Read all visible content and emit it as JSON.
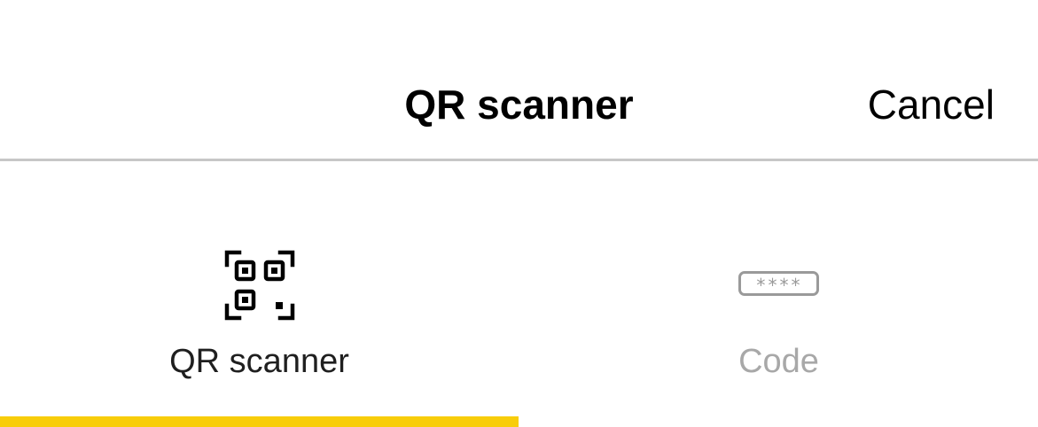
{
  "header": {
    "title": "QR scanner",
    "cancel_label": "Cancel"
  },
  "tabs": [
    {
      "label": "QR scanner",
      "icon": "qr-code-icon",
      "selected": true
    },
    {
      "label": "Code",
      "icon": "code-field-icon",
      "icon_text": "****",
      "selected": false
    }
  ],
  "colors": {
    "accent": "#f8cd0a",
    "divider": "#c7c7c7",
    "inactive_text": "#a8a8a8"
  }
}
